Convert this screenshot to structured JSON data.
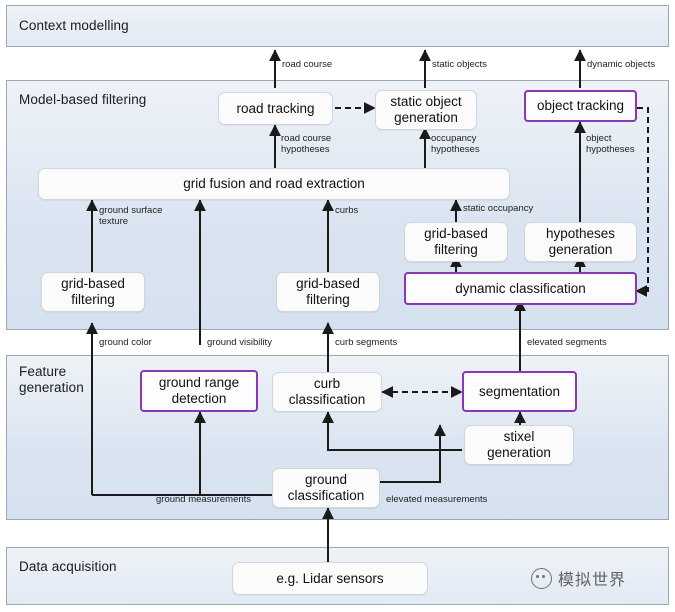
{
  "diagram": {
    "title_hidden": "Perception system layered architecture",
    "accent_highlight": "#8b36b5",
    "band_fill": "#dbe5f1",
    "band_border": "#9aa7b4",
    "node_fill": "#fbfbfc",
    "node_border": "#cfd6de",
    "arrow_color": "#1a1a1a"
  },
  "bands": [
    {
      "id": "context",
      "label": "Context modelling"
    },
    {
      "id": "model",
      "label": "Model-based filtering"
    },
    {
      "id": "feature",
      "label": "Feature\ngeneration"
    },
    {
      "id": "acquisition",
      "label": "Data acquisition"
    }
  ],
  "nodes": [
    {
      "id": "road_tracking",
      "label": "road tracking",
      "highlight": false
    },
    {
      "id": "static_object_gen",
      "label": "static object\ngeneration",
      "highlight": false
    },
    {
      "id": "object_tracking",
      "label": "object tracking",
      "highlight": true
    },
    {
      "id": "grid_fusion",
      "label": "grid fusion and road extraction",
      "highlight": false
    },
    {
      "id": "grid_filter_left",
      "label": "grid-based\nfiltering",
      "highlight": false
    },
    {
      "id": "grid_filter_mid",
      "label": "grid-based\nfiltering",
      "highlight": false
    },
    {
      "id": "grid_filter_right",
      "label": "grid-based\nfiltering",
      "highlight": false
    },
    {
      "id": "hypotheses_gen",
      "label": "hypotheses\ngeneration",
      "highlight": false
    },
    {
      "id": "dynamic_class",
      "label": "dynamic classification",
      "highlight": true
    },
    {
      "id": "ground_range",
      "label": "ground range\ndetection",
      "highlight": true
    },
    {
      "id": "curb_class",
      "label": "curb\nclassification",
      "highlight": false
    },
    {
      "id": "segmentation",
      "label": "segmentation",
      "highlight": true
    },
    {
      "id": "stixel_gen",
      "label": "stixel\ngeneration",
      "highlight": false
    },
    {
      "id": "ground_class",
      "label": "ground\nclassification",
      "highlight": false
    },
    {
      "id": "lidar",
      "label": "e.g. Lidar sensors",
      "highlight": false
    }
  ],
  "edge_labels": [
    {
      "id": "road_course_out",
      "text": "road course"
    },
    {
      "id": "static_objects_out",
      "text": "static objects"
    },
    {
      "id": "dynamic_objects_out",
      "text": "dynamic objects"
    },
    {
      "id": "road_course_hyp",
      "text": "road course\nhypotheses"
    },
    {
      "id": "occupancy_hyp",
      "text": "occupancy\nhypotheses"
    },
    {
      "id": "object_hyp",
      "text": "object\nhypotheses"
    },
    {
      "id": "ground_surface_tex",
      "text": "ground surface\ntexture"
    },
    {
      "id": "curbs",
      "text": "curbs"
    },
    {
      "id": "static_occupancy",
      "text": "static occupancy"
    },
    {
      "id": "ground_color",
      "text": "ground color"
    },
    {
      "id": "ground_visibility",
      "text": "ground visibility"
    },
    {
      "id": "curb_segments",
      "text": "curb segments"
    },
    {
      "id": "elevated_segments",
      "text": "elevated segments"
    },
    {
      "id": "ground_measurements",
      "text": "ground measurements"
    },
    {
      "id": "elevated_measurements",
      "text": "elevated measurements"
    }
  ],
  "watermark": {
    "text": "模拟世界"
  }
}
